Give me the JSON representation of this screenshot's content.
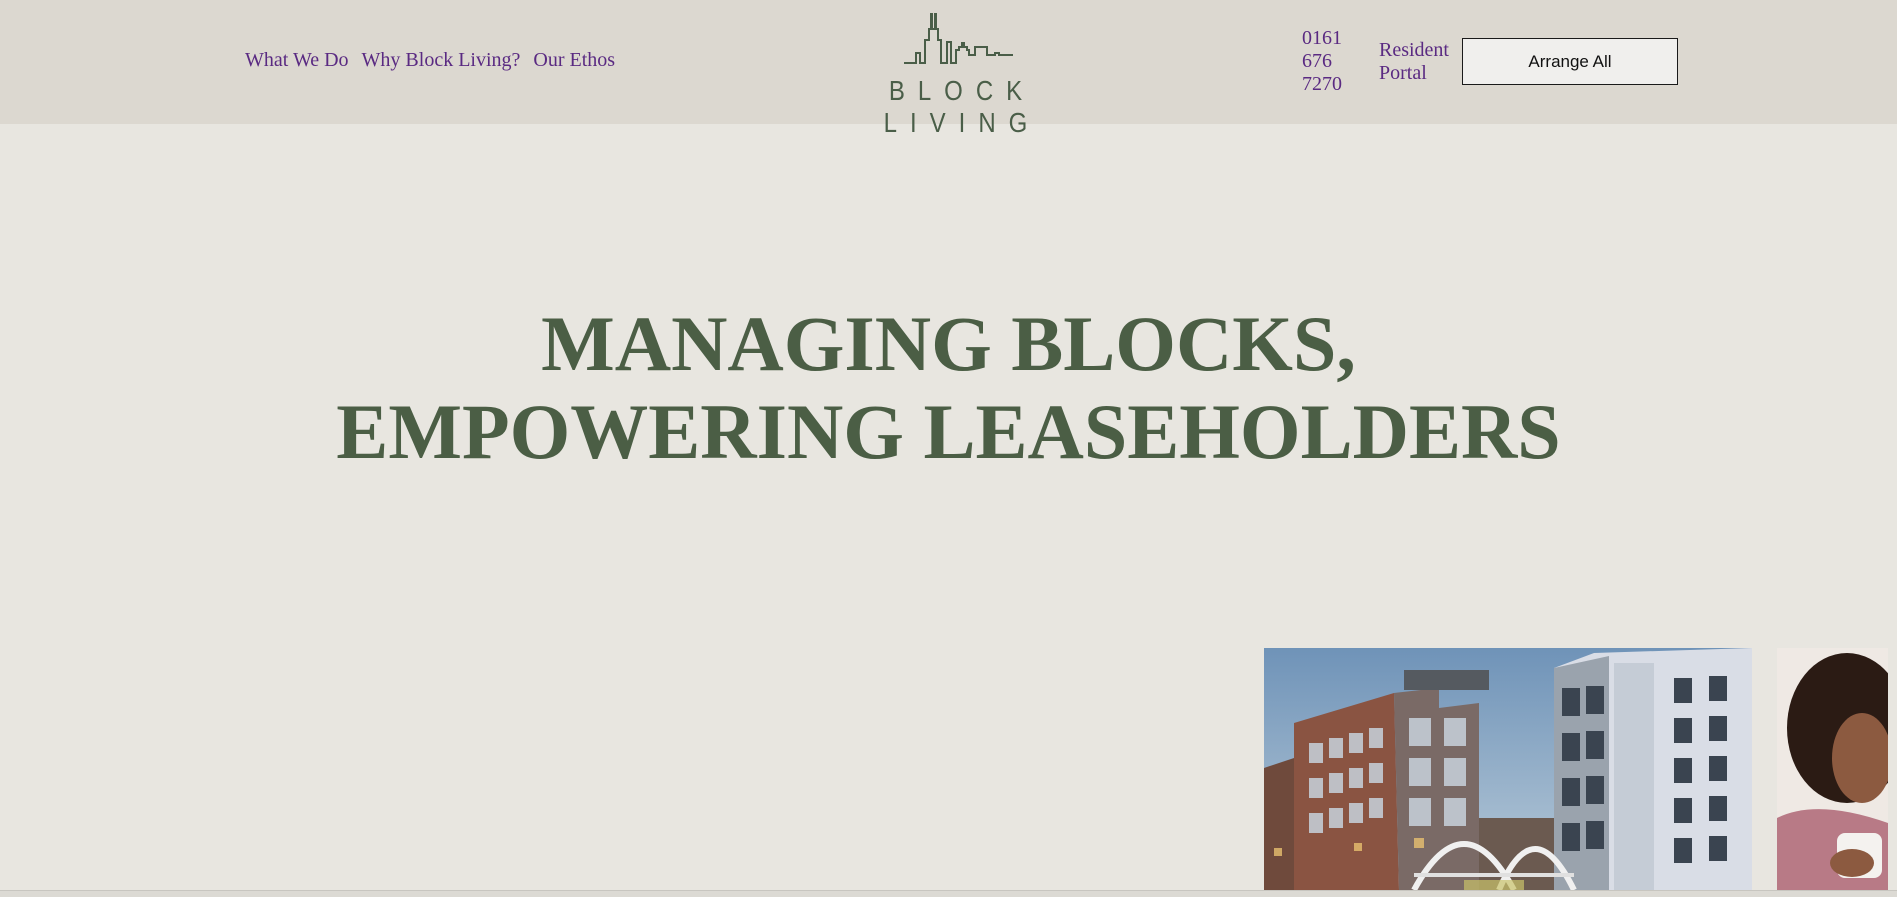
{
  "nav": {
    "items": [
      {
        "label": "What We Do"
      },
      {
        "label": "Why Block Living?"
      },
      {
        "label": "Our Ethos"
      }
    ]
  },
  "logo": {
    "text": "BLOCK LIVING"
  },
  "contact": {
    "phone_line1": "0161",
    "phone_line2": "676",
    "phone_line3": "7270"
  },
  "portal": {
    "line1": "Resident",
    "line2": "Portal"
  },
  "cta": {
    "label": "Arrange All"
  },
  "hero": {
    "line1": "MANAGING BLOCKS,",
    "line2": "EMPOWERING LEASEHOLDERS"
  },
  "colors": {
    "purple": "#5a2a82",
    "green": "#4b5e45",
    "header_bg": "#dcd8d0",
    "page_bg": "#e8e6e0"
  }
}
